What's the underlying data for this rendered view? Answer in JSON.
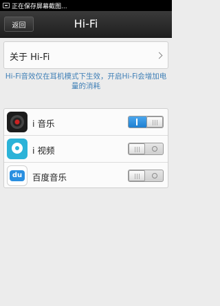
{
  "status_bar": {
    "text": "正在保存屏幕截图..."
  },
  "header": {
    "back_label": "返回",
    "title": "Hi-Fi"
  },
  "about": {
    "label": "关于 Hi-Fi"
  },
  "description": "Hi-Fi音效仅在耳机模式下生效，开启Hi-Fi会增加电量的消耗",
  "apps": [
    {
      "name": "i 音乐",
      "icon": "music-disc-icon",
      "enabled": true
    },
    {
      "name": "i 视频",
      "icon": "video-reel-icon",
      "enabled": false
    },
    {
      "name": "百度音乐",
      "icon": "baidu-du-icon",
      "enabled": false
    }
  ],
  "colors": {
    "toggle_on": "#1e7fd0",
    "description_text": "#3f7fb6",
    "header_bg": "#1f1f1f"
  }
}
